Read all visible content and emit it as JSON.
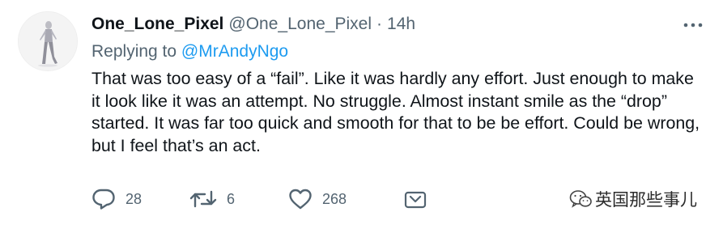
{
  "tweet": {
    "display_name": "One_Lone_Pixel",
    "handle": "@One_Lone_Pixel",
    "separator": "·",
    "time": "14h",
    "replying_prefix": "Replying to",
    "replying_to": "@MrAndyNgo",
    "text": "That was too easy of a “fail”. Like it was hardly any effort. Just enough to make it look like it was an attempt. No struggle. Almost instant smile as the “drop” started. It was far too quick and smooth for that to be be effort. Could be wrong, but I feel that’s an act.",
    "avatar_icon": "figure-avatar-icon"
  },
  "actions": {
    "reply_count": "28",
    "retweet_count": "6",
    "like_count": "268",
    "reply_icon": "reply-icon",
    "retweet_icon": "retweet-icon",
    "like_icon": "heart-icon",
    "share_icon": "share-icon",
    "more_icon": "more-options-icon"
  },
  "watermark": {
    "text": "英国那些事儿",
    "icon": "wechat-icon"
  },
  "colors": {
    "text": "#0f1419",
    "secondary": "#536471",
    "mention": "#1d9bf0",
    "background": "#ffffff"
  }
}
